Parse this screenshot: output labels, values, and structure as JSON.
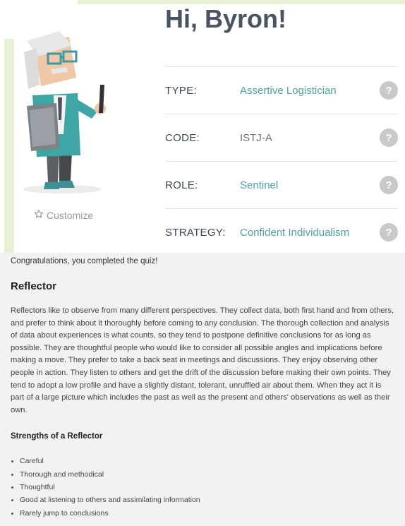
{
  "greeting": "Hi, Byron!",
  "customize_label": "Customize",
  "profile": {
    "rows": [
      {
        "label": "TYPE:",
        "value": "Assertive Logistician",
        "help": "?"
      },
      {
        "label": "CODE:",
        "value": "ISTJ-A",
        "help": "?"
      },
      {
        "label": "ROLE:",
        "value": "Sentinel",
        "help": "?"
      },
      {
        "label": "STRATEGY:",
        "value": "Confident Individualism",
        "help": "?"
      }
    ]
  },
  "content": {
    "congrats": "Congratulations, you completed the quiz!",
    "title": "Reflector",
    "description": "Reflectors like to observe from many different perspectives. They collect data, both first hand and from others, and prefer to think about it thoroughly before coming to any conclusion. The thorough collection and analysis of data about experiences is what counts, so they tend to postpone definitive conclusions for as long as possible. They are thoughtful people who would like to consider all possible angles and implications before making a move. They prefer to take a back seat in meetings and discussions. They enjoy observing other people in action. They listen to others and get the drift of the discussion before making their own points. They tend to adopt a low profile and have a slightly distant, tolerant, unruffled air about them. When they act it is part of a large picture which includes the past as well as the present and others' observations as well as their own.",
    "strengths_title": "Strengths of a Reflector",
    "strengths": [
      "Careful",
      "Thorough and methodical",
      "Thoughtful",
      "Good at listening to others and assimilating information",
      "Rarely jump to conclusions"
    ]
  },
  "colors": {
    "accent_teal": "#4fa0a0",
    "heading": "#4a5460",
    "help_badge": "#c9c9c9",
    "accent_green": "#e6f1d6"
  },
  "icons": {
    "customize": "star-outline-icon",
    "help": "question-circle-icon",
    "avatar": "logistician-character-illustration"
  }
}
